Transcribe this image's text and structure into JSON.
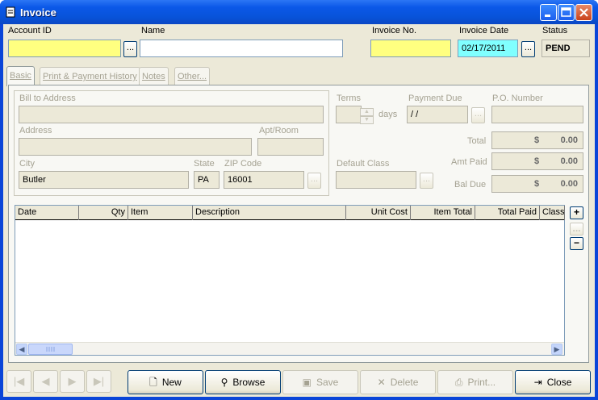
{
  "window": {
    "title": "Invoice"
  },
  "header": {
    "account_id_label": "Account ID",
    "name_label": "Name",
    "invoice_no_label": "Invoice No.",
    "invoice_date_label": "Invoice Date",
    "invoice_date_value": "02/17/2011",
    "status_label": "Status",
    "status_value": "PEND",
    "browse_dots": "..."
  },
  "tabs": [
    {
      "label": "Basic"
    },
    {
      "label": "Print & Payment History"
    },
    {
      "label": "Notes"
    },
    {
      "label": "Other..."
    }
  ],
  "basic": {
    "bill_to_label": "Bill to Address",
    "address_label": "Address",
    "apt_label": "Apt/Room",
    "city_label": "City",
    "city_value": "Butler",
    "state_label": "State",
    "state_value": "PA",
    "zip_label": "ZIP Code",
    "zip_value": "16001",
    "terms_label": "Terms",
    "days_label": "days",
    "payment_due_label": "Payment Due",
    "payment_due_value": " / /",
    "po_label": "P.O. Number",
    "total_label": "Total",
    "total_currency": "$",
    "total_value": "0.00",
    "amt_paid_label": "Amt Paid",
    "amt_paid_currency": "$",
    "amt_paid_value": "0.00",
    "bal_due_label": "Bal Due",
    "bal_due_currency": "$",
    "bal_due_value": "0.00",
    "default_class_label": "Default Class"
  },
  "grid": {
    "columns": [
      "Date",
      "Qty",
      "Item",
      "Description",
      "Unit Cost",
      "Item Total",
      "Total Paid",
      "Class"
    ],
    "add_label": "+",
    "edit_label": "...",
    "remove_label": "−"
  },
  "actions": {
    "nav_first": "|◀",
    "nav_prev": "◀",
    "nav_next": "▶",
    "nav_last": "▶|",
    "new_label": "New",
    "browse_label": "Browse",
    "save_label": "Save",
    "delete_label": "Delete",
    "print_label": "Print...",
    "close_label": "Close"
  }
}
